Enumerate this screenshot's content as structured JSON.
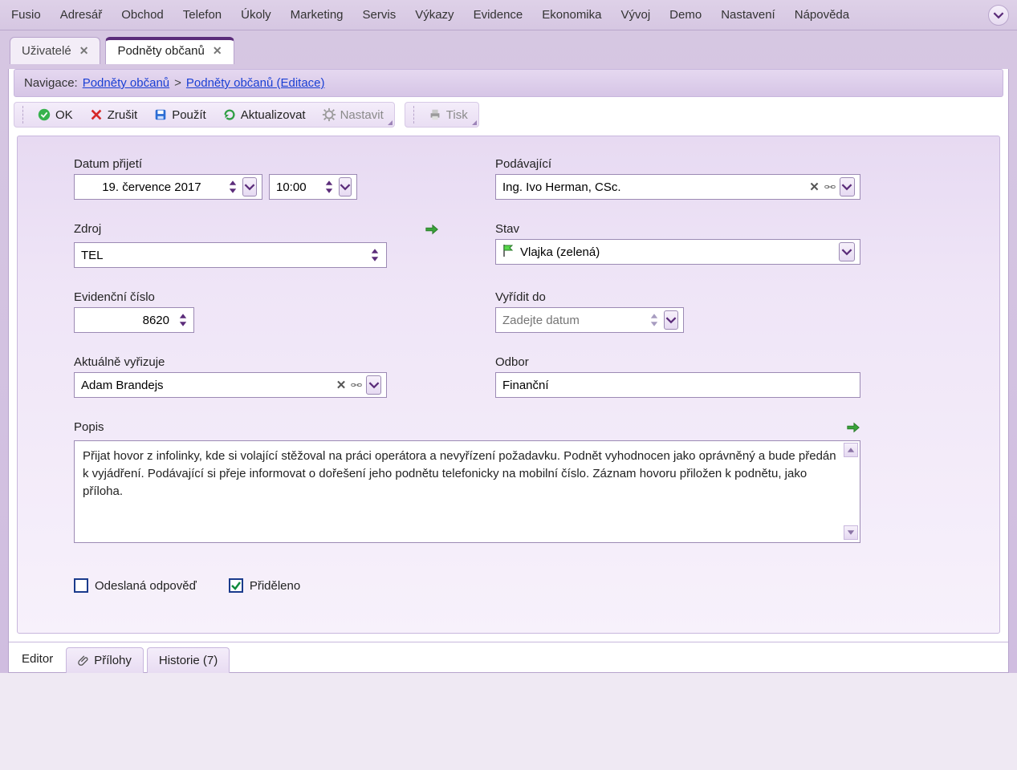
{
  "menubar": {
    "items": [
      "Fusio",
      "Adresář",
      "Obchod",
      "Telefon",
      "Úkoly",
      "Marketing",
      "Servis",
      "Výkazy",
      "Evidence",
      "Ekonomika",
      "Vývoj",
      "Demo",
      "Nastavení",
      "Nápověda"
    ]
  },
  "tabs": {
    "items": [
      {
        "label": "Uživatelé",
        "active": false
      },
      {
        "label": "Podněty občanů",
        "active": true
      }
    ]
  },
  "breadcrumb": {
    "prefix": "Navigace:",
    "link1": "Podněty občanů",
    "sep": ">",
    "link2": "Podněty občanů (Editace)"
  },
  "toolbar": {
    "ok": "OK",
    "cancel": "Zrušit",
    "apply": "Použít",
    "refresh": "Aktualizovat",
    "settings": "Nastavit",
    "print": "Tisk"
  },
  "form": {
    "date_label": "Datum přijetí",
    "date_value": "19. července 2017",
    "time_value": "10:00",
    "submitter_label": "Podávající",
    "submitter_value": "Ing. Ivo Herman, CSc.",
    "source_label": "Zdroj",
    "source_value": "TEL",
    "state_label": "Stav",
    "state_value": "Vlajka (zelená)",
    "evnum_label": "Evidenční číslo",
    "evnum_value": "8620",
    "due_label": "Vyřídit do",
    "due_placeholder": "Zadejte datum",
    "assignee_label": "Aktuálně vyřizuje",
    "assignee_value": "Adam Brandejs",
    "dept_label": "Odbor",
    "dept_value": "Finanční",
    "desc_label": "Popis",
    "desc_value": "Přijat hovor z infolinky, kde si volající stěžoval na práci operátora a nevyřízení požadavku. Podnět vyhodnocen jako oprávněný a bude předán k vyjádření. Podávající si přeje informovat o dořešení jeho podnětu telefonicky na mobilní číslo. Záznam hovoru přiložen k podnětu, jako příloha.",
    "chk_sent_label": "Odeslaná odpověď",
    "chk_sent_checked": false,
    "chk_assigned_label": "Přiděleno",
    "chk_assigned_checked": true
  },
  "bottom_tabs": {
    "editor": "Editor",
    "attachments": "Přílohy",
    "history": "Historie (7)"
  }
}
